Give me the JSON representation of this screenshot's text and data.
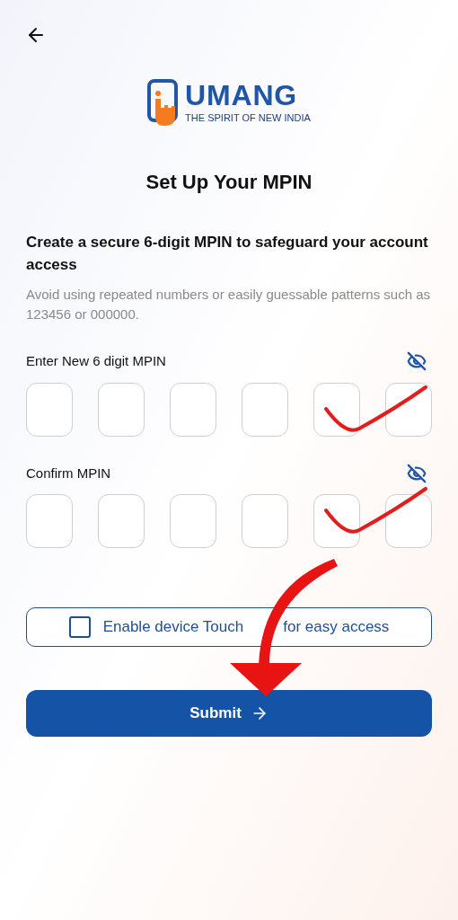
{
  "logo": {
    "name": "UMANG",
    "tagline": "THE SPIRIT OF NEW INDIA"
  },
  "title": "Set Up Your MPIN",
  "heading": "Create a secure 6-digit MPIN to safeguard your account access",
  "hint": "Avoid using repeated numbers or easily guessable patterns such as 123456 or 000000.",
  "pin_fields": [
    {
      "label": "Enter New 6 digit MPIN",
      "visible": false
    },
    {
      "label": "Confirm MPIN",
      "visible": false
    }
  ],
  "touch_option": {
    "label_parts": [
      "Enable device Touch",
      "for easy access"
    ],
    "checked": false
  },
  "submit": {
    "label": "Submit"
  },
  "annotations": [
    {
      "kind": "tick"
    },
    {
      "kind": "tick"
    },
    {
      "kind": "arrow"
    }
  ]
}
